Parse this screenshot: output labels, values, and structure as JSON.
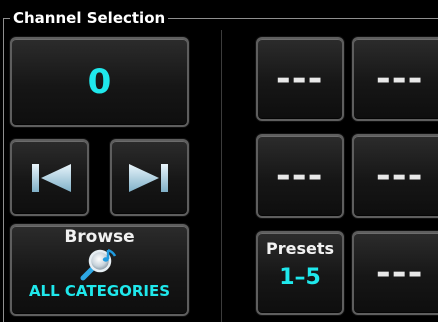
{
  "panel": {
    "title": "Channel Selection"
  },
  "channel": {
    "value": "0"
  },
  "browse": {
    "title": "Browse",
    "category": "ALL CATEGORIES",
    "icon": "music-search-icon"
  },
  "presets": {
    "title": "Presets",
    "range": "1–5"
  },
  "preset_slots": [
    {
      "label": "---"
    },
    {
      "label": "---"
    },
    {
      "label": "---"
    },
    {
      "label": "---"
    },
    {
      "label": "---"
    }
  ],
  "colors": {
    "accent": "#1fe8ec",
    "background": "#000000",
    "button_border": "#5e5e5e"
  }
}
